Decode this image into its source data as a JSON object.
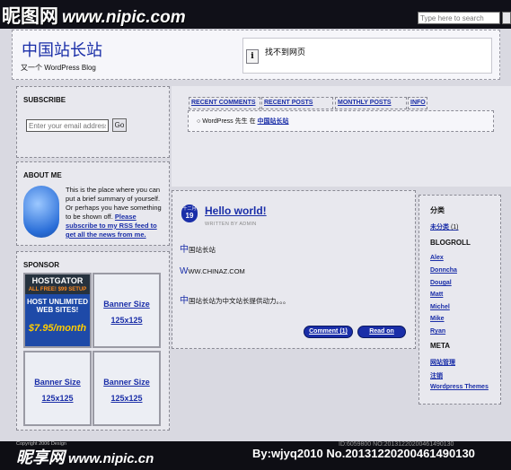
{
  "watermark": {
    "top_logo": "昵图网",
    "top_url": "www.nipic.com",
    "bottom_logo": "昵享网",
    "bottom_url": "www.nipic.cn",
    "by_line": "By:wjyq2010  No.20131220200461490130",
    "copyright": "Copyright 2006 Design",
    "faint_no": "ID:6059800 NO:20131220200461490130"
  },
  "search": {
    "placeholder": "Type here to search"
  },
  "header": {
    "title": "中国站长站",
    "description": "又一个 WordPress Blog",
    "error_text": "找不到网页",
    "error_icon": "i"
  },
  "subscribe": {
    "title": "SUBSCRIBE",
    "email_placeholder": "Enter your email address...",
    "go_label": "Go"
  },
  "about": {
    "title": "ABOUT ME",
    "text": "This is the place where you can put a brief summary of yourself. Or perhaps you have something to be shown off.",
    "link": "Please subscribe to my RSS feed to get all the news from me."
  },
  "sponsor": {
    "title": "SPONSOR",
    "hostgator": {
      "brand": "HOSTGATOR",
      "tagline": "ALL FREE! $99 SETUP",
      "line1": "HOST UNLIMITED",
      "line2": "WEB SITES!",
      "price": "$7.95/month"
    },
    "ads": [
      {
        "label1": "Banner Size",
        "label2": "125x125"
      },
      {
        "label1": "Banner Size",
        "label2": "125x125"
      },
      {
        "label1": "Banner Size",
        "label2": "125x125"
      }
    ]
  },
  "tabs": {
    "items": [
      "RECENT COMMENTS",
      "RECENT POSTS",
      "MONTHLY POSTS",
      "INFO"
    ],
    "content_prefix": "WordPress 先生",
    "content_on": "在",
    "content_link": "中国站长站"
  },
  "post": {
    "date_month": "十二月",
    "date_day": "19",
    "title": "Hello world!",
    "meta": "WRITTEN BY ADMIN",
    "lines": [
      {
        "cap": "中",
        "text": "国站长站"
      },
      {
        "cap": "W",
        "text": "WW.CHINAZ.COM"
      },
      {
        "cap": "中",
        "text": "国站长站为中文站长提供动力。。。"
      }
    ],
    "comment_label": "Comment (1)",
    "read_on_label": "Read on"
  },
  "sidebar": {
    "categories_title": "分类",
    "categories": [
      {
        "label": "未分类",
        "count": "(1)"
      }
    ],
    "blogroll_title": "BLOGROLL",
    "blogroll": [
      "Alex",
      "Donncha",
      "Dougal",
      "Matt",
      "Michel",
      "Mike",
      "Ryan"
    ],
    "meta_title": "META",
    "meta": [
      "网站管理",
      "注销",
      "Wordpress Themes"
    ]
  }
}
